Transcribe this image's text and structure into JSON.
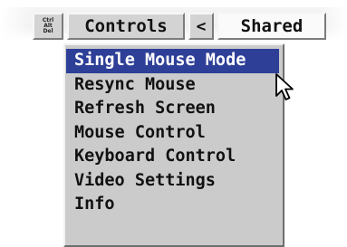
{
  "toolbar": {
    "cad_label": [
      "Ctrl",
      "Alt",
      "Del"
    ],
    "controls_label": "Controls",
    "prev_label": "<",
    "shared_label": "Shared"
  },
  "menu": {
    "items": [
      {
        "label": "Single Mouse Mode",
        "selected": true
      },
      {
        "label": "Resync Mouse",
        "selected": false
      },
      {
        "label": "Refresh Screen",
        "selected": false
      },
      {
        "label": "Mouse Control",
        "selected": false
      },
      {
        "label": "Keyboard Control",
        "selected": false
      },
      {
        "label": "Video Settings",
        "selected": false
      },
      {
        "label": "Info",
        "selected": false
      }
    ]
  },
  "colors": {
    "selection": "#2e3f97",
    "menu_bg": "#cbcbcb"
  },
  "icons": {
    "pointer": "mouse-pointer-icon"
  }
}
